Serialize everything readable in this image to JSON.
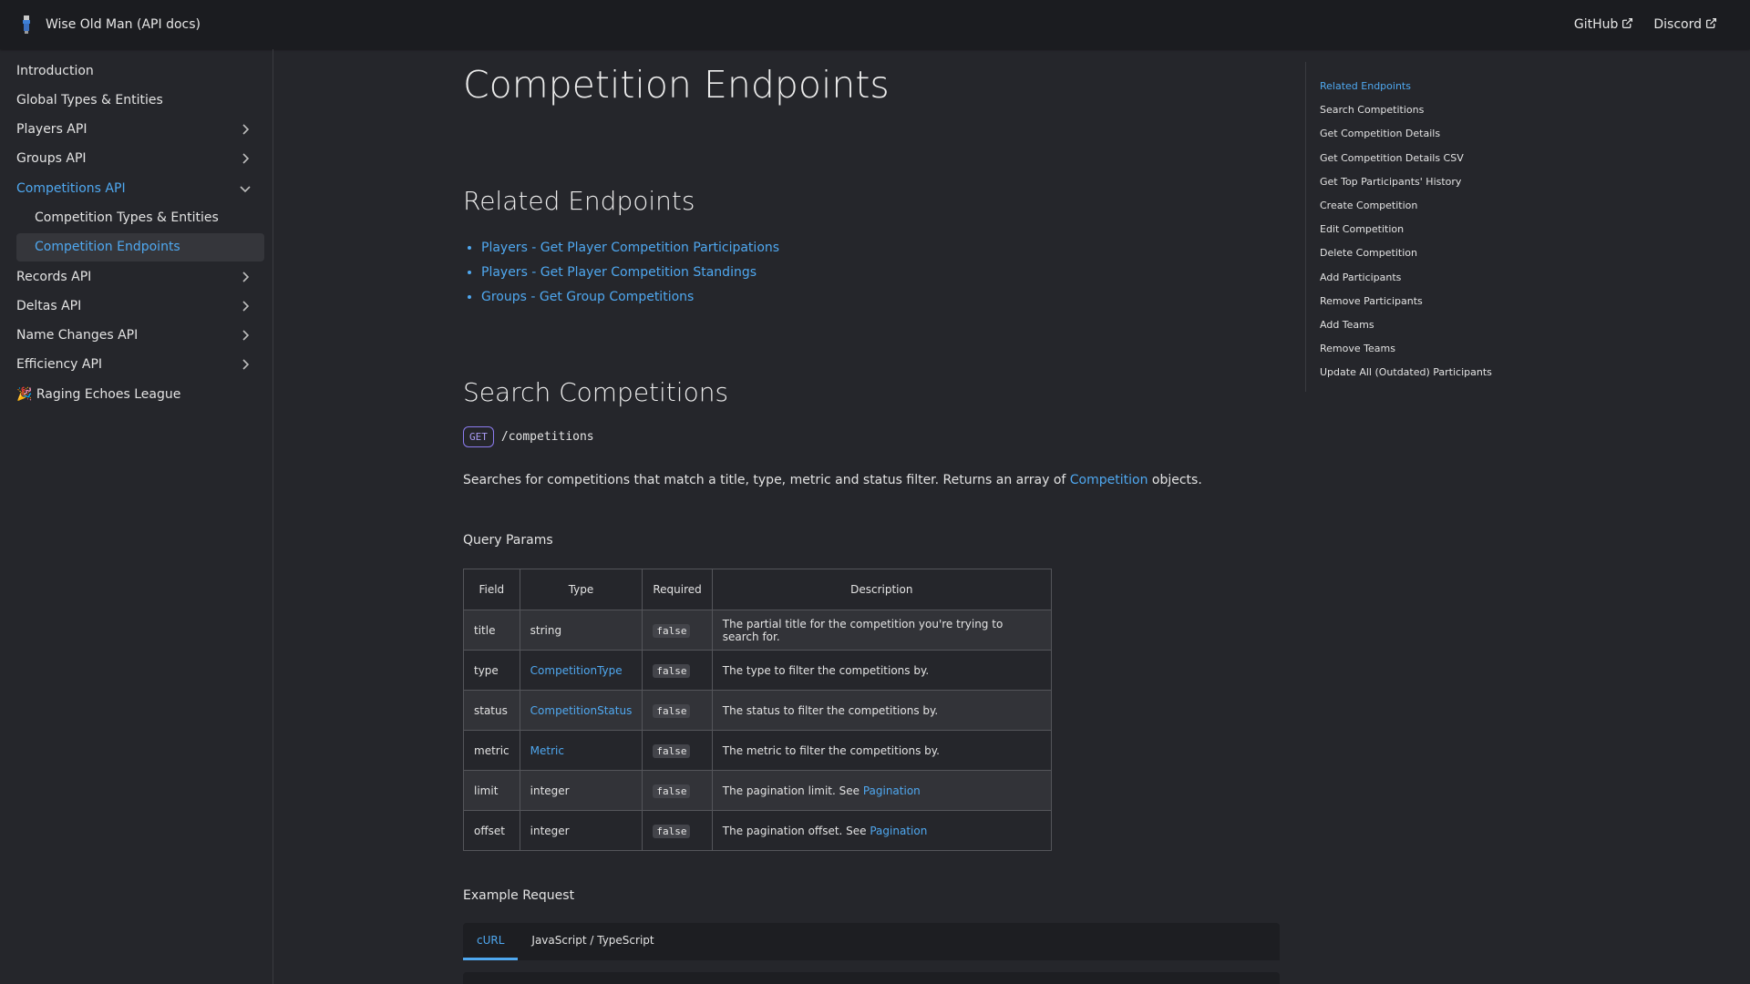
{
  "navbar": {
    "title": "Wise Old Man (API docs)",
    "links": [
      {
        "label": "GitHub"
      },
      {
        "label": "Discord"
      }
    ]
  },
  "sidebar": {
    "items": [
      {
        "label": "Introduction"
      },
      {
        "label": "Global Types & Entities"
      },
      {
        "label": "Players API"
      },
      {
        "label": "Groups API"
      },
      {
        "label": "Competitions API"
      },
      {
        "label": "Competition Types & Entities"
      },
      {
        "label": "Competition Endpoints"
      },
      {
        "label": "Records API"
      },
      {
        "label": "Deltas API"
      },
      {
        "label": "Name Changes API"
      },
      {
        "label": "Efficiency API"
      },
      {
        "label": "🎉 Raging Echoes League"
      }
    ]
  },
  "main": {
    "title": "Competition Endpoints",
    "related": {
      "heading": "Related Endpoints",
      "links": [
        "Players - Get Player Competition Participations",
        "Players - Get Player Competition Standings",
        "Groups - Get Group Competitions"
      ]
    },
    "search": {
      "heading": "Search Competitions",
      "method": "GET",
      "path": "/competitions",
      "desc_before": "Searches for competitions that match a title, type, metric and status filter. Returns an array of ",
      "desc_link": "Competition",
      "desc_after": " objects.",
      "query_label": "Query Params",
      "columns": [
        "Field",
        "Type",
        "Required",
        "Description"
      ],
      "rows": [
        {
          "field": "title",
          "type": "string",
          "required": "false",
          "desc": "The partial title for the competition you're trying to search for.",
          "desc_link": ""
        },
        {
          "field": "type",
          "type": "CompetitionType",
          "required": "false",
          "desc": "The type to filter the competitions by.",
          "desc_link": ""
        },
        {
          "field": "status",
          "type": "CompetitionStatus",
          "required": "false",
          "desc": "The status to filter the competitions by.",
          "desc_link": ""
        },
        {
          "field": "metric",
          "type": "Metric",
          "required": "false",
          "desc": "The metric to filter the competitions by.",
          "desc_link": ""
        },
        {
          "field": "limit",
          "type": "integer",
          "required": "false",
          "desc": "The pagination limit. See ",
          "desc_link": "Pagination"
        },
        {
          "field": "offset",
          "type": "integer",
          "required": "false",
          "desc": "The pagination offset. See ",
          "desc_link": "Pagination"
        }
      ],
      "example_label": "Example Request",
      "tabs": [
        "cURL",
        "JavaScript / TypeScript"
      ]
    }
  },
  "toc": {
    "items": [
      "Related Endpoints",
      "Search Competitions",
      "Get Competition Details",
      "Get Competition Details CSV",
      "Get Top Participants' History",
      "Create Competition",
      "Edit Competition",
      "Delete Competition",
      "Add Participants",
      "Remove Participants",
      "Add Teams",
      "Remove Teams",
      "Update All (Outdated) Participants"
    ]
  },
  "colors": {
    "accent": "#4fa8f0",
    "background": "#25262b",
    "navbar": "#1b1c20",
    "method_badge": "#8c7cf0"
  }
}
